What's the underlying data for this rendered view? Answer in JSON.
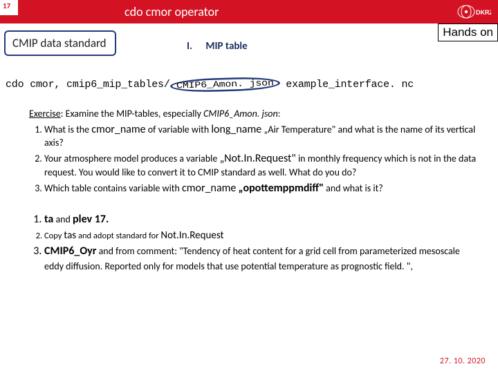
{
  "slide_number": "17",
  "title": "cdo cmor operator",
  "hands_on": "Hands on",
  "tab": "CMIP data standard",
  "section": {
    "rn": "I.",
    "name": "MIP table"
  },
  "cmd": {
    "pre": "cdo cmor, cmip6_mip_tables/",
    "circ": "CMIP6_Amon. json",
    "post": " example_interface. nc"
  },
  "exercise": {
    "lead_u": "Exercise",
    "lead_rest": ": Examine the MIP-tables, especially ",
    "lead_em": "CMIP6_Amon. json",
    "lead_colon": ":",
    "q1a": "What is the ",
    "q1b": "cmor_name",
    "q1c": " of variable with ",
    "q1d": "long_name",
    "q1e": " „Air Temperature\" and what is the name of its vertical axis?",
    "q2a": "Your atmosphere model produces a variable ",
    "q2b": "„Not.In.Request\"",
    "q2c": " in monthly frequency which is not in the data request. You would like to convert it to CMIP standard as well. What do you do?",
    "q3a": "Which table contains variable with ",
    "q3b": "cmor_name",
    "q3c": " ",
    "q3d": "„opottemppmdiff\"",
    "q3e": " and what is it?"
  },
  "answers": {
    "a1a": "ta",
    "a1b": " and ",
    "a1c": "plev 17.",
    "a2a": "Copy ",
    "a2b": "tas",
    "a2c": " and adopt standard for ",
    "a2d": "Not.In.Request",
    "a3a": "CMIP6_Oyr",
    "a3b": " and from comment: \"Tendency of heat content for a grid cell from parameterized mesoscale eddy diffusion. Reported only for models that use potential temperature as prognostic field. \","
  },
  "date": "27. 10. 2020"
}
